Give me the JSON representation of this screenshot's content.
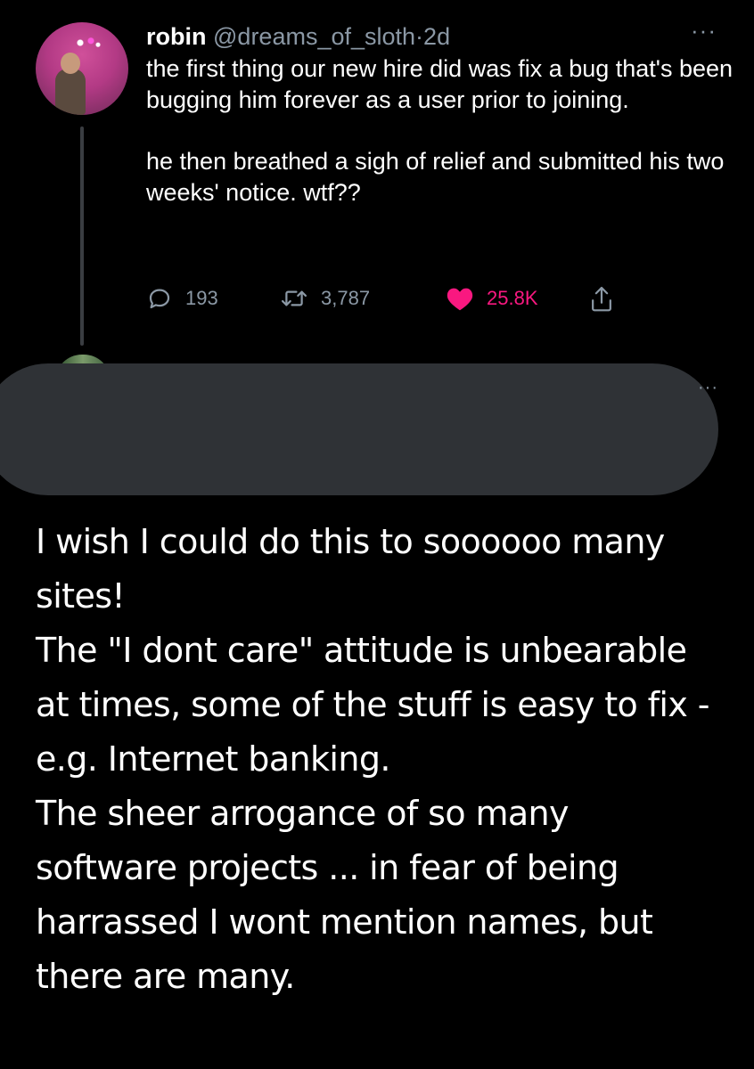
{
  "tweet": {
    "author_name": "robin",
    "author_handle": "@dreams_of_sloth",
    "separator": "·",
    "time": "2d",
    "more_icon": "ellipsis-icon",
    "paragraphs": [
      "the first thing our new hire did was fix a bug that's been bugging him forever as a user prior to joining.",
      "he then breathed a sigh of relief and submitted his two weeks' notice. wtf??"
    ],
    "actions": {
      "replies": "193",
      "retweets": "3,787",
      "likes": "25.8K"
    },
    "colors": {
      "like": "#f91880",
      "secondary": "#8b98a5"
    }
  },
  "reply": {
    "more_icon": "ellipsis-icon",
    "header_redacted": true
  },
  "comment": {
    "lines": [
      "I wish I could do this to soooooo many",
      "sites!",
      "The \"I dont care\" attitude is unbearable",
      "at times, some of the stuff is easy to fix -",
      "e.g. Internet banking.",
      "The sheer arrogance of so many",
      "software projects ... in fear of being",
      "harrassed I wont mention names, but",
      "there are many."
    ]
  }
}
